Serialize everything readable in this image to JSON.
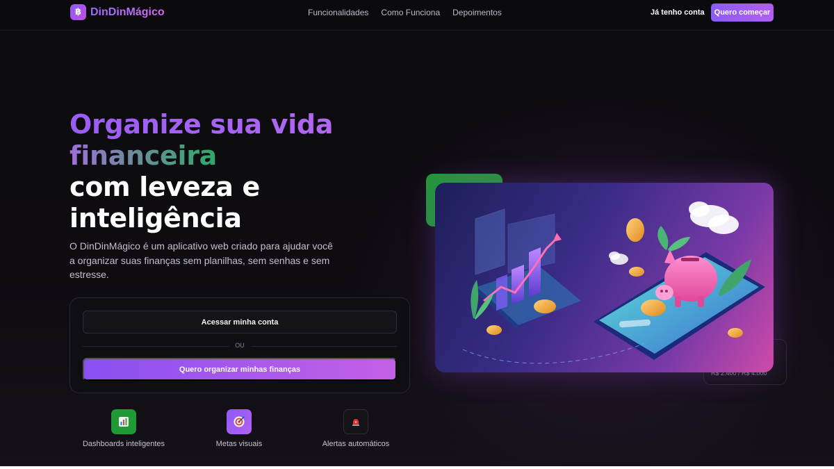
{
  "nav": {
    "brand_logo_glyph": "฿",
    "brand_name": "DinDinMágico",
    "links": [
      "Funcionalidades",
      "Como Funciona",
      "Depoimentos"
    ],
    "login_label": "Já tenho conta",
    "cta_label": "Quero começar"
  },
  "hero": {
    "title_line1": "Organize sua vida",
    "title_line2": "financeira",
    "title_line3": "com leveza e",
    "title_line4": "inteligência",
    "description": "O DinDinMágico é um aplicativo web criado para ajudar você a organizar suas finanças sem planilhas, sem senhas e sem estresse."
  },
  "auth": {
    "access_label": "Acessar minha conta",
    "or_label": "OU",
    "primary_label": "Quero organizar minhas finanças"
  },
  "features": [
    {
      "label": "Dashboards inteligentes",
      "icon": "bar-chart-icon",
      "glyph": "📊",
      "color": "#1f9a34"
    },
    {
      "label": "Metas visuais",
      "icon": "target-icon",
      "glyph": "🎯",
      "color": "#8b5cf6"
    },
    {
      "label": "Alertas automáticos",
      "icon": "alarm-icon",
      "glyph": "🚨",
      "color": "#141317"
    }
  ],
  "illustration": {
    "back_card_amount": "R$ 2.400 / R$ 4.000"
  },
  "colors": {
    "accent_purple": "#8b5cf6",
    "accent_pink": "#c460e6",
    "accent_green": "#1f9a34",
    "background": "#0b0a0d"
  }
}
